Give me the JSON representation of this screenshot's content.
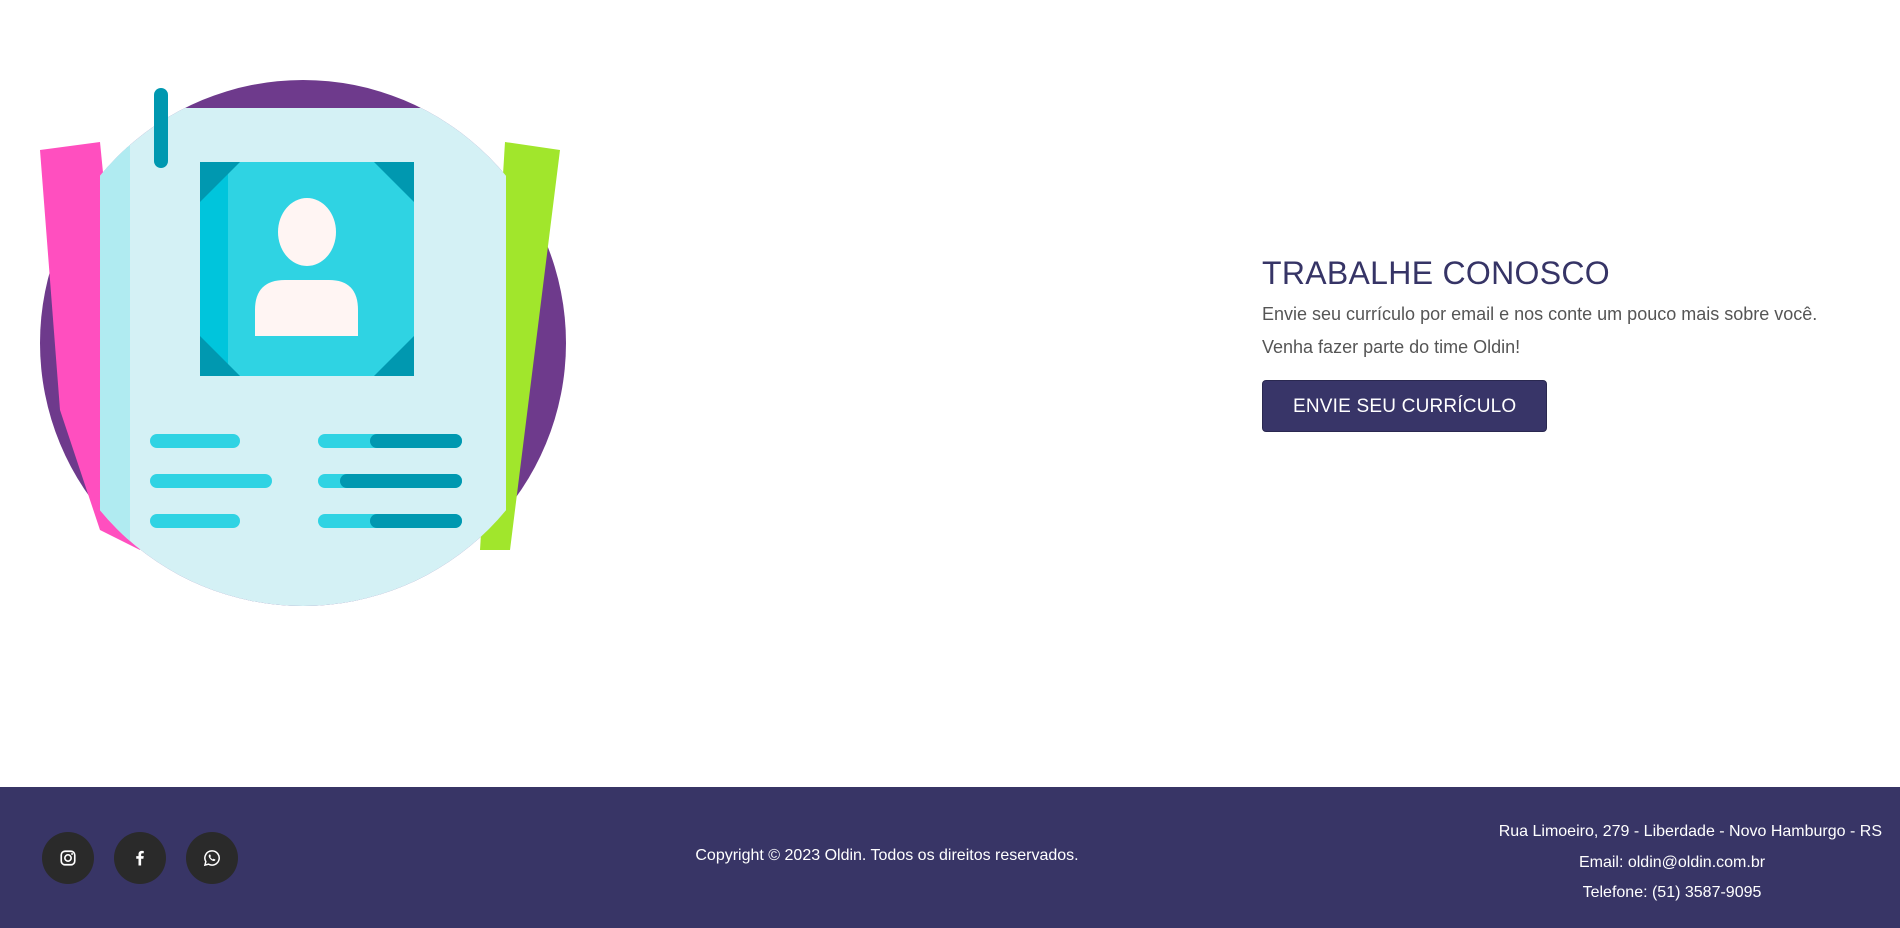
{
  "main": {
    "title": "TRABALHE CONOSCO",
    "subtitle": "Envie seu currículo por email e nos conte um pouco mais sobre você.",
    "subtitle2": "Venha fazer parte do time Oldin!",
    "button_label": "ENVIE SEU CURRÍCULO",
    "illustration_icon": "resume-icon",
    "colors": {
      "brand": "#383566",
      "button": "#383568",
      "circle": "#6e3a8c",
      "paper_pink": "#ff4fbf",
      "paper_green": "#a1e62c",
      "sheet": "#d4f1f5",
      "accent_cyan": "#2fd3e3",
      "accent_teal": "#0098b0"
    }
  },
  "footer": {
    "social": [
      {
        "name": "instagram-icon"
      },
      {
        "name": "facebook-icon"
      },
      {
        "name": "whatsapp-icon"
      }
    ],
    "copyright": "Copyright © 2023 Oldin. Todos os direitos reservados.",
    "address": "Rua Limoeiro, 279 - Liberdade - Novo Hamburgo - RS",
    "email": "Email: oldin@oldin.com.br",
    "phone": "Telefone: (51) 3587-9095"
  }
}
